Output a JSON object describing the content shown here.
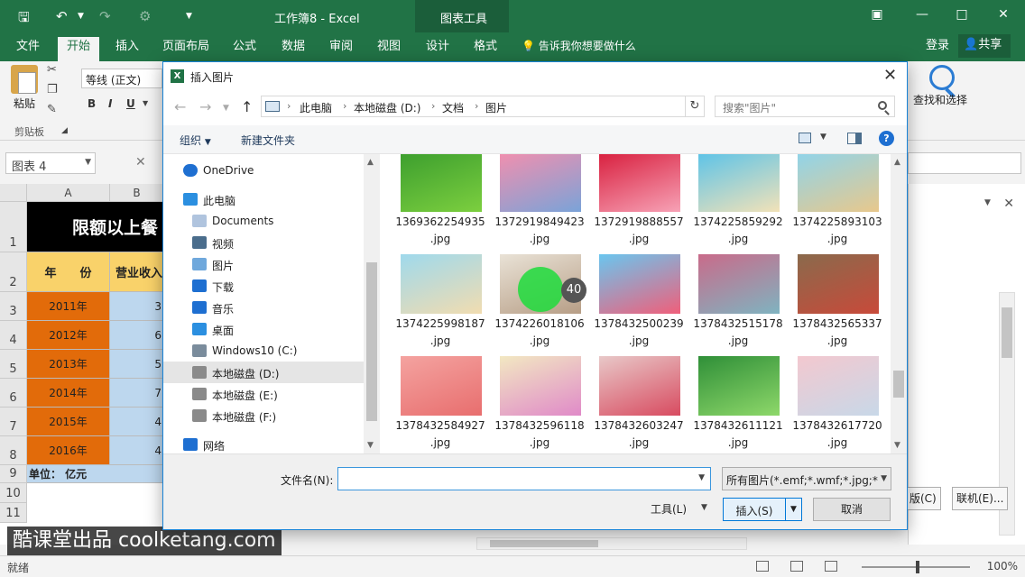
{
  "window": {
    "title": "工作簿8 - Excel",
    "context_tab_group": "图表工具"
  },
  "tabs": [
    "文件",
    "开始",
    "插入",
    "页面布局",
    "公式",
    "数据",
    "审阅",
    "视图",
    "设计",
    "格式"
  ],
  "active_tab": "开始",
  "tell_me": "告诉我你想要做什么",
  "account": {
    "login": "登录",
    "share": "共享"
  },
  "ribbon": {
    "paste": "粘贴",
    "clipboard_group": "剪贴板",
    "font_name": "等线 (正文)",
    "bold": "B",
    "italic": "I",
    "underline": "U",
    "find_select": "查找和选择"
  },
  "name_box": "图表 4",
  "sheet": {
    "columns": [
      "A",
      "B"
    ],
    "rows": [
      "1",
      "2",
      "3",
      "4",
      "5",
      "6",
      "7",
      "8",
      "9",
      "10",
      "11"
    ],
    "title": "限额以上餐",
    "headers": [
      "年　　份",
      "营业收入"
    ],
    "data": [
      {
        "year": "2011年",
        "value": "3"
      },
      {
        "year": "2012年",
        "value": "6"
      },
      {
        "year": "2013年",
        "value": "5"
      },
      {
        "year": "2014年",
        "value": "7"
      },
      {
        "year": "2015年",
        "value": "4"
      },
      {
        "year": "2016年",
        "value": "4"
      }
    ],
    "unit": "单位：  亿元"
  },
  "right_pane": {
    "btn1": "版(C)",
    "btn2": "联机(E)..."
  },
  "status": {
    "ready": "就绪",
    "zoom": "100%"
  },
  "watermark": "酷课堂出品 coolketang.com",
  "dialog": {
    "title": "插入图片",
    "breadcrumbs": [
      "此电脑",
      "本地磁盘 (D:)",
      "文档",
      "图片"
    ],
    "search_placeholder": "搜索\"图片\"",
    "organize": "组织",
    "new_folder": "新建文件夹",
    "nav_items": [
      {
        "label": "OneDrive",
        "icon": "onedrive-icon"
      },
      {
        "label": "此电脑",
        "icon": "computer-icon"
      },
      {
        "label": "Documents",
        "icon": "documents-icon"
      },
      {
        "label": "视频",
        "icon": "video-icon"
      },
      {
        "label": "图片",
        "icon": "pictures-icon"
      },
      {
        "label": "下载",
        "icon": "download-icon"
      },
      {
        "label": "音乐",
        "icon": "music-icon"
      },
      {
        "label": "桌面",
        "icon": "desktop-icon"
      },
      {
        "label": "Windows10 (C:)",
        "icon": "system-drive-icon"
      },
      {
        "label": "本地磁盘 (D:)",
        "icon": "drive-icon"
      },
      {
        "label": "本地磁盘 (E:)",
        "icon": "drive-icon"
      },
      {
        "label": "本地磁盘 (F:)",
        "icon": "drive-icon"
      },
      {
        "label": "网络",
        "icon": "network-icon"
      }
    ],
    "selected_nav": "本地磁盘 (D:)",
    "files": [
      {
        "name": "1369362254935",
        "ext": ".jpg",
        "colors": [
          "#3c9e2e",
          "#7ccf3f"
        ]
      },
      {
        "name": "1372919849423",
        "ext": ".jpg",
        "colors": [
          "#f28fae",
          "#7aa3d8"
        ]
      },
      {
        "name": "1372919888557",
        "ext": ".jpg",
        "colors": [
          "#d81f3e",
          "#f7a2b6"
        ]
      },
      {
        "name": "1374225859292",
        "ext": ".jpg",
        "colors": [
          "#5cc3e8",
          "#f2e2b8"
        ]
      },
      {
        "name": "1374225893103",
        "ext": ".jpg",
        "colors": [
          "#8fd4ea",
          "#e8c88c"
        ]
      },
      {
        "name": "1374225998187",
        "ext": ".jpg",
        "colors": [
          "#9fd9ec",
          "#f1dcb0"
        ]
      },
      {
        "name": "1374226018106",
        "ext": ".jpg",
        "colors": [
          "#e9e2d6",
          "#b79e86"
        ]
      },
      {
        "name": "1378432500239",
        "ext": ".jpg",
        "colors": [
          "#6ac6ef",
          "#f05f7a"
        ]
      },
      {
        "name": "1378432515178",
        "ext": ".jpg",
        "colors": [
          "#c96b8a",
          "#7fb3c0"
        ]
      },
      {
        "name": "1378432565337",
        "ext": ".jpg",
        "colors": [
          "#8a6a4c",
          "#c84a3a"
        ]
      },
      {
        "name": "1378432584927",
        "ext": ".jpg",
        "colors": [
          "#f4a3a0",
          "#e86e6e"
        ]
      },
      {
        "name": "1378432596118",
        "ext": ".jpg",
        "colors": [
          "#f2e8c2",
          "#e08ac8"
        ]
      },
      {
        "name": "1378432603247",
        "ext": ".jpg",
        "colors": [
          "#e8c8c8",
          "#d84b60"
        ]
      },
      {
        "name": "1378432611121",
        "ext": ".jpg",
        "colors": [
          "#2f8f38",
          "#8ed86a"
        ]
      },
      {
        "name": "1378432617720",
        "ext": ".jpg",
        "colors": [
          "#f3c8cf",
          "#c8d8e8"
        ]
      }
    ],
    "filename_label": "文件名(N):",
    "filename_value": "",
    "file_type": "所有图片(*.emf;*.wmf;*.jpg;*.jp",
    "tools": "工具(L)",
    "insert": "插入(S)",
    "cancel": "取消"
  },
  "cursor_step": "40"
}
